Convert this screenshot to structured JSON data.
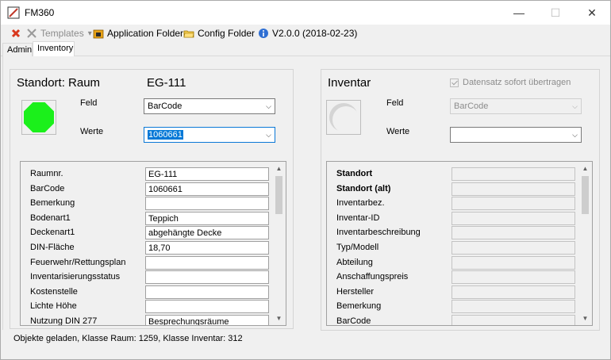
{
  "window": {
    "title": "FM360",
    "controls": {
      "minimize": "—",
      "maximize": "☐",
      "close": "✕"
    }
  },
  "toolbar": {
    "delete_icon": "delete-icon",
    "templates_label": "Templates",
    "templates_dropdown": "▾",
    "app_folder_label": "Application Folder",
    "config_folder_label": "Config Folder",
    "version_label": "V2.0.0 (2018-02-23)"
  },
  "tabs": [
    {
      "label": "Admin"
    },
    {
      "label": "Inventory"
    }
  ],
  "left": {
    "title": "Standort: Raum",
    "room": "EG-111",
    "status_color": "#1bf01b",
    "feld_label": "Feld",
    "feld_value": "BarCode",
    "werte_label": "Werte",
    "werte_value": "1060661",
    "properties": [
      {
        "label": "Raumnr.",
        "value": "EG-111"
      },
      {
        "label": "BarCode",
        "value": "1060661"
      },
      {
        "label": "Bemerkung",
        "value": ""
      },
      {
        "label": "Bodenart1",
        "value": "Teppich"
      },
      {
        "label": "Deckenart1",
        "value": "abgehängte Decke"
      },
      {
        "label": "DIN-Fläche",
        "value": "18,70"
      },
      {
        "label": "Feuerwehr/Rettungsplan",
        "value": ""
      },
      {
        "label": "Inventarisierungsstatus",
        "value": ""
      },
      {
        "label": "Kostenstelle",
        "value": ""
      },
      {
        "label": "Lichte Höhe",
        "value": ""
      },
      {
        "label": "Nutzung DIN 277",
        "value": "Besprechungsräume"
      }
    ]
  },
  "right": {
    "title": "Inventar",
    "checkbox_label": "Datensatz sofort übertragen",
    "feld_label": "Feld",
    "feld_value": "BarCode",
    "werte_label": "Werte",
    "werte_value": "",
    "properties": [
      {
        "label": "Standort",
        "value": "",
        "bold": true
      },
      {
        "label": "Standort (alt)",
        "value": "",
        "bold": true
      },
      {
        "label": "Inventarbez.",
        "value": ""
      },
      {
        "label": "Inventar-ID",
        "value": ""
      },
      {
        "label": "Inventarbeschreibung",
        "value": ""
      },
      {
        "label": "Typ/Modell",
        "value": ""
      },
      {
        "label": "Abteilung",
        "value": ""
      },
      {
        "label": "Anschaffungspreis",
        "value": ""
      },
      {
        "label": "Hersteller",
        "value": ""
      },
      {
        "label": "Bemerkung",
        "value": ""
      },
      {
        "label": "BarCode",
        "value": ""
      }
    ]
  },
  "status_text": "Objekte geladen, Klasse Raum: 1259, Klasse Inventar: 312"
}
